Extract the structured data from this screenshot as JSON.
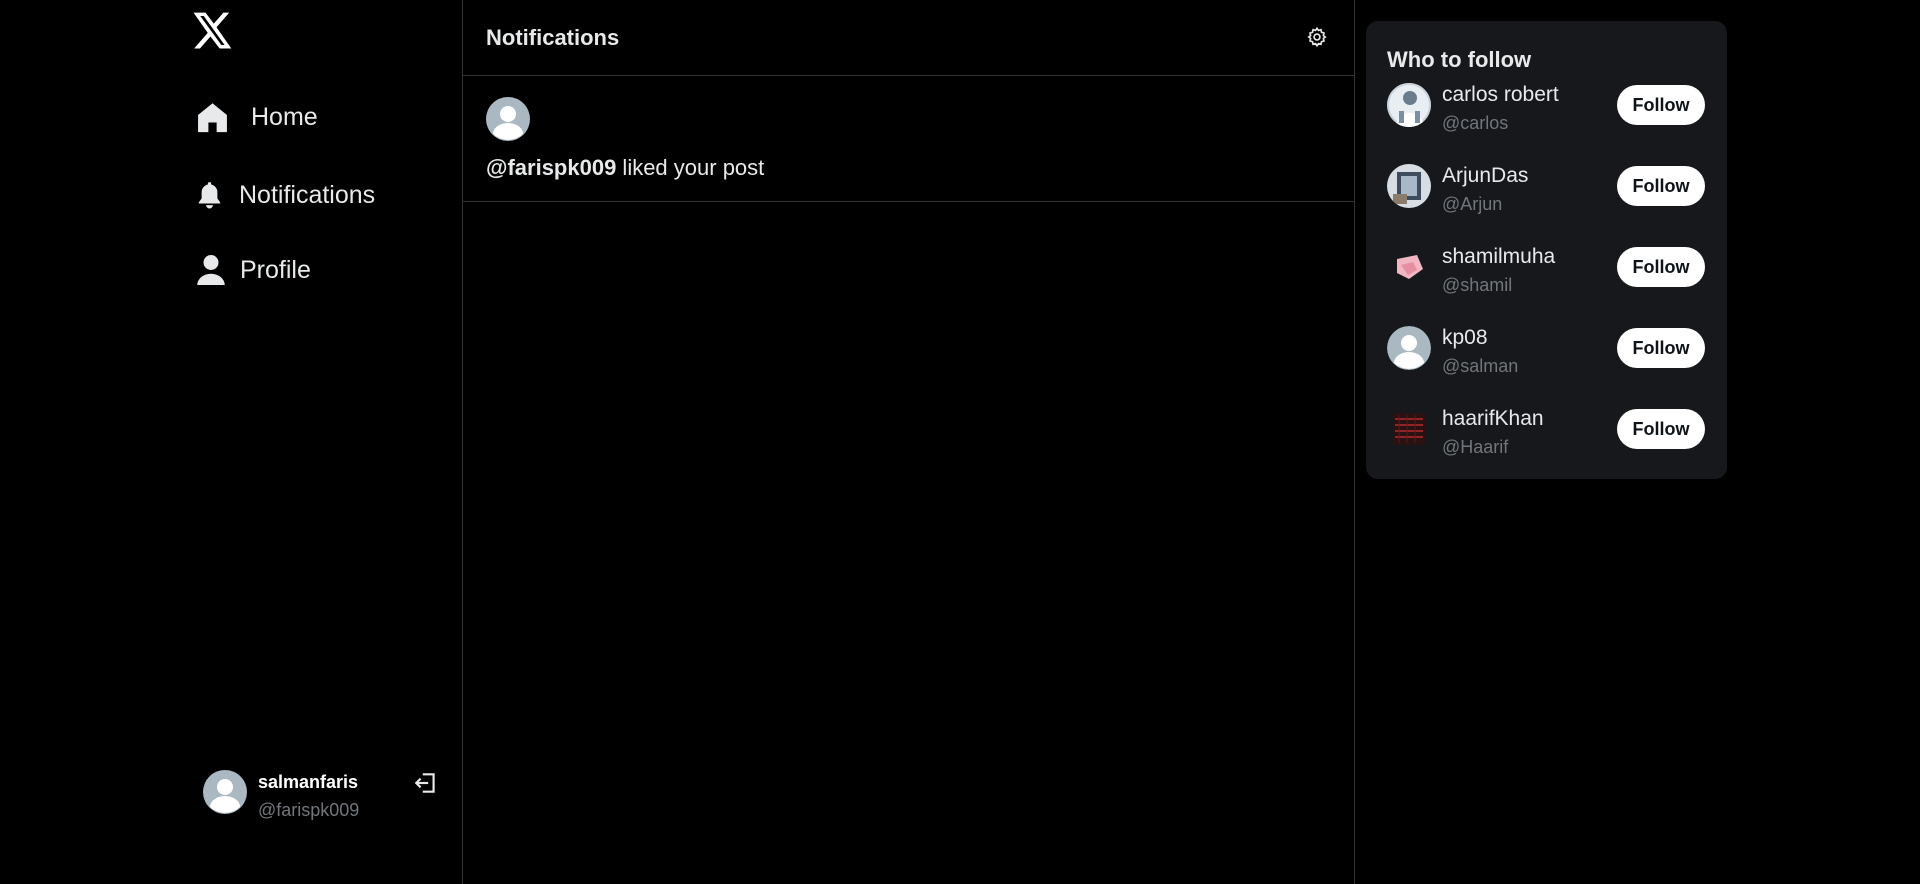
{
  "nav": {
    "home": "Home",
    "notifications": "Notifications",
    "profile": "Profile"
  },
  "account": {
    "name": "salmanfaris",
    "handle": "@farispk009"
  },
  "main": {
    "title": "Notifications",
    "notifications": [
      {
        "user": "@farispk009",
        "text": " liked your post"
      }
    ]
  },
  "who_to_follow": {
    "title": "Who to follow",
    "follow_label": "Follow",
    "users": [
      {
        "name": "carlos robert",
        "handle": "@carlos"
      },
      {
        "name": "ArjunDas",
        "handle": "@Arjun"
      },
      {
        "name": "shamilmuha",
        "handle": "@shamil"
      },
      {
        "name": "kp08",
        "handle": "@salman"
      },
      {
        "name": "haarifKhan",
        "handle": "@Haarif"
      }
    ]
  },
  "colors": {
    "background": "#000000",
    "panel": "#16181c",
    "border": "#2f3336",
    "muted_text": "#71767b",
    "default_avatar": "#aab8c2"
  }
}
